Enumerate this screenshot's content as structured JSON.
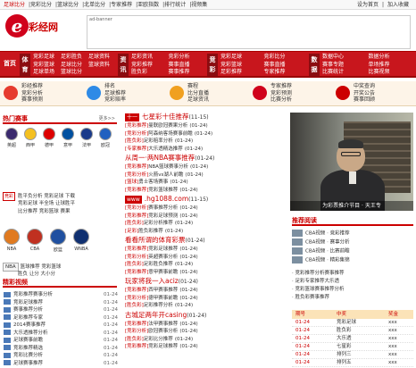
{
  "topbar": {
    "links": [
      "足球比分",
      "|竞彩比分",
      "|篮球比分",
      "|北单比分",
      "|专家推荐",
      "|亚欧指数",
      "|排行统计",
      "|视频集"
    ],
    "right": [
      "设为首页",
      "|",
      "加入收藏"
    ]
  },
  "logo": {
    "mark": "e",
    "text": "彩经网"
  },
  "banner": {
    "alt": "ad-banner"
  },
  "nav": {
    "home": "首页",
    "blocks": [
      {
        "cat": "体育",
        "items": [
          "竞彩足球",
          "竞彩篮球",
          "足球单场",
          "足彩胜负",
          "足球比分",
          "篮球比分",
          "足球资料",
          "篮球资料"
        ]
      },
      {
        "cat": "资讯",
        "items": [
          "足彩资讯",
          "竞彩推荐",
          "胜负彩",
          "竞彩分析",
          "赛事直播",
          "赛事推荐"
        ]
      },
      {
        "cat": "竞彩",
        "items": [
          "竞彩足球",
          "竞彩篮球",
          "足彩推荐",
          "竞彩比分",
          "赛事直播",
          "专家推荐"
        ]
      },
      {
        "cat": "数据",
        "items": [
          "数据中心",
          "赛事专题",
          "比赛统计",
          "数据分析",
          "单场推荐",
          "比赛视频"
        ]
      }
    ]
  },
  "subbar": [
    {
      "color": "#e63b2e",
      "lines": [
        "彩经推荐",
        "竞彩分析",
        "赛事预测"
      ]
    },
    {
      "color": "#2e8ae6",
      "lines": [
        "排名",
        "足球推荐",
        "竞彩赔率"
      ]
    },
    {
      "color": "#f0a020",
      "lines": [
        "赛程",
        "比分直播",
        "足球资讯"
      ]
    },
    {
      "color": "#d0021b",
      "lines": [
        "专家推荐",
        "竞彩预测",
        "比赛分析"
      ]
    },
    {
      "color": "#c00",
      "lines": [
        "中奖查询",
        "开奖公告",
        "赛事回顾"
      ]
    }
  ],
  "hotmatch": {
    "title": "热门赛事",
    "more": "更多>>",
    "teams": [
      "英超",
      "西甲",
      "德甲",
      "意甲",
      "法甲",
      "欧冠"
    ]
  },
  "cg": {
    "tag": "竞彩",
    "rows": [
      "胜平负分析 竞彩足球 下载",
      "竞彩足球 半全场 让球胜平",
      "比分推荐 竞彩篮球 赛果"
    ]
  },
  "bball": {
    "teams": [
      "NBA",
      "CBA",
      "欧篮",
      "WNBA"
    ],
    "tags": [
      "NBA",
      "CBA"
    ],
    "rows": [
      "篮球推荐 竞彩篮球",
      "胜负 让分 大小分"
    ]
  },
  "news": [
    {
      "tag": "十一",
      "head": "七星彩十佳推荐",
      "date": "(11-15)",
      "lines": [
        [
          "[竞彩推荐]",
          "曼联欧冠赛果分析",
          "(01-24)"
        ],
        [
          "[竞彩分析]",
          "阿森纳客场赛事前瞻",
          "(01-24)"
        ],
        [
          "[胜负彩]",
          "足彩赔率分析",
          "(01-24)"
        ],
        [
          "[专家推荐]",
          "大乐透精选推荐",
          "(01-24)"
        ]
      ]
    },
    {
      "tag": "",
      "head": "从周一·两NBA赛事推荐",
      "date": "(01-24)",
      "lines": [
        [
          "[竞彩推荐]",
          "NBA篮球赛事分析",
          "(01-24)"
        ],
        [
          "[竞彩分析]",
          "火箭vs湖人前瞻",
          "(01-24)"
        ],
        [
          "[篮球]",
          "勇士客场赛事",
          "(01-24)"
        ],
        [
          "[竞彩推荐]",
          "竞彩篮球推荐",
          "(01-24)"
        ]
      ]
    },
    {
      "tag": "www",
      "head": ".hg1088.com",
      "date": "(11-15)",
      "lines": [
        [
          "[竞彩分析]",
          "赛事推荐分析",
          "(01-24)"
        ],
        [
          "[竞彩推荐]",
          "竞彩足球预测",
          "(01-24)"
        ],
        [
          "[胜负彩]",
          "足彩分析推荐",
          "(01-24)"
        ],
        [
          "[足彩]",
          "胜负彩推荐",
          "(01-24)"
        ]
      ]
    },
    {
      "tag": "",
      "head": "看看所谓的体育彩票",
      "date": "(01-24)",
      "lines": [
        [
          "[竞彩推荐]",
          "竞彩足球推荐",
          "(01-24)"
        ],
        [
          "[竞彩分析]",
          "英超赛事分析",
          "(01-24)"
        ],
        [
          "[胜负彩]",
          "足彩胜负推荐",
          "(01-24)"
        ],
        [
          "[竞彩推荐]",
          "意甲赛事前瞻",
          "(01-24)"
        ]
      ]
    },
    {
      "tag": "",
      "head": "玩家将我一入aciz",
      "date": "(01-24)",
      "lines": [
        [
          "[竞彩推荐]",
          "西甲赛事推荐",
          "(01-24)"
        ],
        [
          "[竞彩分析]",
          "德甲赛事前瞻",
          "(01-24)"
        ],
        [
          "[胜负彩]",
          "足彩推荐分析",
          "(01-24)"
        ]
      ]
    },
    {
      "tag": "",
      "head": "古城足两年开casing",
      "date": "(01-24)",
      "lines": [
        [
          "[竞彩推荐]",
          "法甲赛事推荐",
          "(01-24)"
        ],
        [
          "[竞彩分析]",
          "欧冠赛事分析",
          "(01-24)"
        ],
        [
          "[胜负彩]",
          "足彩比分推荐",
          "(01-24)"
        ],
        [
          "[竞彩推荐]",
          "竞彩足球推荐",
          "(01-24)"
        ]
      ]
    }
  ],
  "video": {
    "caption": "为彩票推介节目 · 天王专"
  },
  "recommend": {
    "title": "推荐阅读",
    "rows": [
      "CBA视频 · 竞彩推荐",
      "CBA视频 · 赛事分析",
      "CBA视频 · 比赛前瞻",
      "CBA视频 · 精彩集锦"
    ]
  },
  "bullets": [
    "· 竞彩推荐分析赛事推荐",
    "· 足彩专家推荐大乐透",
    "· 竞彩篮球赛事推荐分析",
    "· 胜负彩赛事推荐"
  ],
  "table": {
    "headers": [
      "期号",
      "中奖",
      "奖金"
    ],
    "rows": [
      [
        "01-24",
        "竞彩足球",
        "xxx"
      ],
      [
        "01-24",
        "胜负彩",
        "xxx"
      ],
      [
        "01-24",
        "大乐透",
        "xxx"
      ],
      [
        "01-24",
        "七星彩",
        "xxx"
      ],
      [
        "01-24",
        "排列三",
        "xxx"
      ],
      [
        "01-24",
        "排列五",
        "xxx"
      ]
    ]
  },
  "featured": {
    "title": "精彩视频",
    "more": "更多>>",
    "rows": [
      [
        "竞彩推荐赛事分析",
        "01-24"
      ],
      [
        "竞彩足球推荐",
        "01-24"
      ],
      [
        "赛事推荐分析",
        "01-24"
      ],
      [
        "足彩推荐专家",
        "01-24"
      ],
      [
        "2014赛事推荐",
        "01-24"
      ],
      [
        "大乐透推荐分析",
        "01-24"
      ],
      [
        "足球赛事前瞻",
        "01-24"
      ],
      [
        "竞彩推荐精选",
        "01-24"
      ],
      [
        "竞彩比赛分析",
        "01-24"
      ],
      [
        "足球赛事推荐",
        "01-24"
      ]
    ]
  }
}
